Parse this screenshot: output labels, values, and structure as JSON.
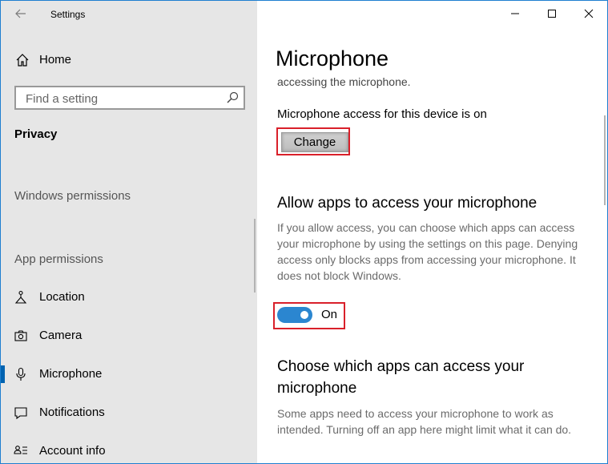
{
  "window": {
    "title": "Settings"
  },
  "sidebar": {
    "home_label": "Home",
    "search_placeholder": "Find a setting",
    "section_title": "Privacy",
    "groups": {
      "windows_permissions": "Windows permissions",
      "app_permissions": "App permissions"
    },
    "items": [
      {
        "label": "Location",
        "icon": "location-icon"
      },
      {
        "label": "Camera",
        "icon": "camera-icon"
      },
      {
        "label": "Microphone",
        "icon": "microphone-icon",
        "selected": true
      },
      {
        "label": "Notifications",
        "icon": "notifications-icon"
      },
      {
        "label": "Account info",
        "icon": "account-info-icon"
      }
    ]
  },
  "main": {
    "page_title": "Microphone",
    "partial_text": "accessing the microphone.",
    "device_access_text": "Microphone access for this device is on",
    "change_label": "Change",
    "allow_heading": "Allow apps to access your microphone",
    "allow_description": "If you allow access, you can choose which apps can access your microphone by using the settings on this page. Denying access only blocks apps from accessing your microphone. It does not block Windows.",
    "toggle_state": "On",
    "choose_heading_line1": "Choose which apps can access your",
    "choose_heading_line2": "microphone",
    "choose_description": "Some apps need to access your microphone to work as intended. Turning off an app here might limit what it can do."
  },
  "colors": {
    "accent": "#0063b1",
    "toggle_on": "#2b86d0",
    "highlight_box": "#d9202a",
    "sidebar_bg": "#e6e6e6"
  }
}
